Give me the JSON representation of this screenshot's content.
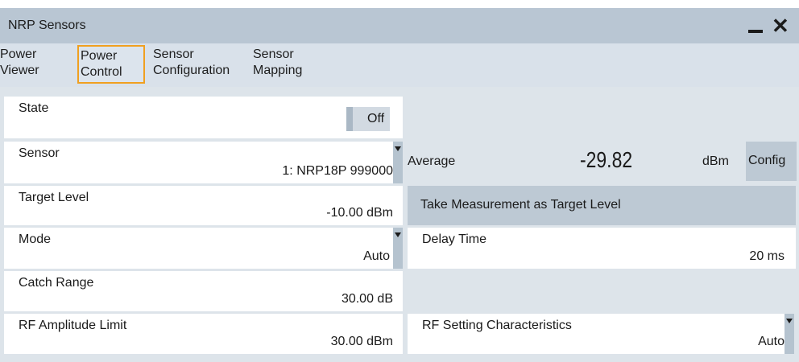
{
  "window": {
    "title": "NRP Sensors",
    "minimize_icon": "minimize-icon",
    "close_icon": "close-icon",
    "close_glyph": "✕"
  },
  "tabs": [
    {
      "line1": "Power",
      "line2": "Viewer",
      "active": false
    },
    {
      "line1": "Power",
      "line2": "Control",
      "active": true
    },
    {
      "line1": "Sensor",
      "line2": "Configuration",
      "active": false
    },
    {
      "line1": "Sensor",
      "line2": "Mapping",
      "active": false
    }
  ],
  "left": {
    "state": {
      "label": "State",
      "value": "Off"
    },
    "sensor": {
      "label": "Sensor",
      "value": "1: NRP18P 999000"
    },
    "target_level": {
      "label": "Target Level",
      "value": "-10.00 dBm"
    },
    "mode": {
      "label": "Mode",
      "value": "Auto"
    },
    "catch_range": {
      "label": "Catch Range",
      "value": "30.00 dB"
    },
    "rf_amplitude_limit": {
      "label": "RF Amplitude Limit",
      "value": "30.00 dBm"
    }
  },
  "right": {
    "average": {
      "label": "Average",
      "value": "-29.82",
      "unit": "dBm",
      "config_label": "Config"
    },
    "take_measurement_label": "Take Measurement as Target Level",
    "delay_time": {
      "label": "Delay Time",
      "value": "20 ms"
    },
    "rf_setting_characteristics": {
      "label": "RF Setting Characteristics",
      "value": "Auto"
    }
  },
  "colors": {
    "titlebar": "#b9c6d3",
    "tabbar": "#d9e1ea",
    "panel": "#dde4ea",
    "active_tab_border": "#f0a020",
    "button": "#bdc9d4"
  }
}
